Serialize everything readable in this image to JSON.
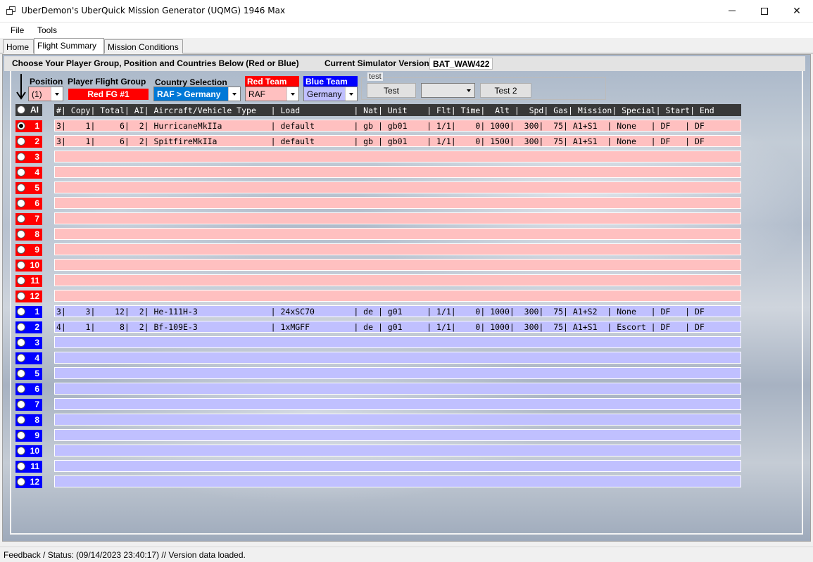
{
  "window": {
    "title": "UberDemon's UberQuick Mission Generator (UQMG) 1946 Max"
  },
  "menu": {
    "file": "File",
    "tools": "Tools"
  },
  "tabs": [
    {
      "label": "Home"
    },
    {
      "label": "Flight Summary"
    },
    {
      "label": "Mission Conditions"
    }
  ],
  "header": {
    "instructions": "Choose Your Player Group, Position and Countries Below (Red or Blue)",
    "sim_label": "Current Simulator Version:",
    "sim_value": "BAT_WAW422"
  },
  "controls": {
    "position_label": "Position",
    "position_value": "(1)",
    "player_group_label": "Player Flight Group",
    "player_group_value": "Red FG #1",
    "country_label": "Country Selection",
    "country_value": "RAF > Germany",
    "red_team_label": "Red Team",
    "red_team_value": "RAF",
    "blue_team_label": "Blue Team",
    "blue_team_value": "Germany",
    "test_group_label": "test",
    "test_button": "Test",
    "test_combo_value": "",
    "test2_button": "Test 2"
  },
  "colors": {
    "red_team": "#ff0000",
    "blue_team": "#0000ff",
    "red_row": "#ffc0c0",
    "blue_row": "#c0c0ff",
    "country_select": "#0078d7",
    "header": "#383838"
  },
  "grid": {
    "ai_label": "AI",
    "header": "#| Copy| Total| AI| Aircraft/Vehicle Type   | Load           | Nat| Unit    | Flt| Time|  Alt |  Spd| Gas| Mission| Special| Start| End",
    "red_rows": [
      {
        "num": "1",
        "text": "3|    1|     6|  2| HurricaneMkIIa          | default        | gb | gb01    | 1/1|    0| 1000|  300|  75| A1+S1  | None   | DF   | DF"
      },
      {
        "num": "2",
        "text": "3|    1|     6|  2| SpitfireMkIIa           | default        | gb | gb01    | 1/1|    0| 1500|  300|  75| A1+S1  | None   | DF   | DF"
      },
      {
        "num": "3",
        "text": ""
      },
      {
        "num": "4",
        "text": ""
      },
      {
        "num": "5",
        "text": ""
      },
      {
        "num": "6",
        "text": ""
      },
      {
        "num": "7",
        "text": ""
      },
      {
        "num": "8",
        "text": ""
      },
      {
        "num": "9",
        "text": ""
      },
      {
        "num": "10",
        "text": ""
      },
      {
        "num": "11",
        "text": ""
      },
      {
        "num": "12",
        "text": ""
      }
    ],
    "blue_rows": [
      {
        "num": "1",
        "text": "3|    3|    12|  2| He-111H-3               | 24xSC70        | de | g01     | 1/1|    0| 1000|  300|  75| A1+S2  | None   | DF   | DF"
      },
      {
        "num": "2",
        "text": "4|    1|     8|  2| Bf-109E-3               | 1xMGFF         | de | g01     | 1/1|    0| 1000|  300|  75| A1+S1  | Escort | DF   | DF"
      },
      {
        "num": "3",
        "text": ""
      },
      {
        "num": "4",
        "text": ""
      },
      {
        "num": "5",
        "text": ""
      },
      {
        "num": "6",
        "text": ""
      },
      {
        "num": "7",
        "text": ""
      },
      {
        "num": "8",
        "text": ""
      },
      {
        "num": "9",
        "text": ""
      },
      {
        "num": "10",
        "text": ""
      },
      {
        "num": "11",
        "text": ""
      },
      {
        "num": "12",
        "text": ""
      }
    ]
  },
  "status": {
    "label": "Feedback / Status:",
    "message": "(09/14/2023 23:40:17) // Version data loaded."
  }
}
